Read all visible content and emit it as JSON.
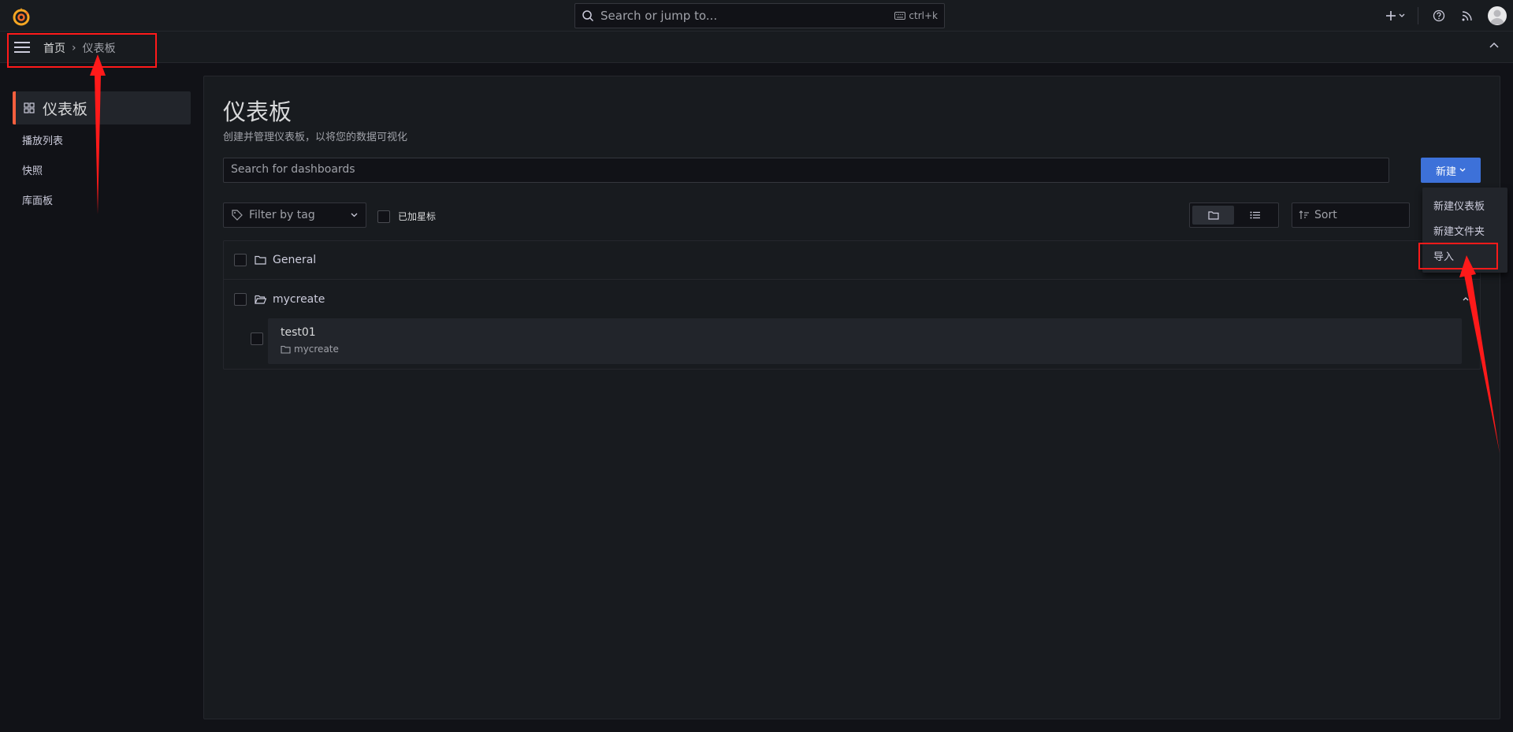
{
  "topbar": {
    "search_placeholder": "Search or jump to...",
    "shortcut": "ctrl+k"
  },
  "breadcrumb": {
    "home": "首页",
    "separator": "›",
    "current": "仪表板"
  },
  "sidebar": {
    "active_label": "仪表板",
    "items": [
      {
        "label": "播放列表"
      },
      {
        "label": "快照"
      },
      {
        "label": "库面板"
      }
    ]
  },
  "main": {
    "title": "仪表板",
    "subtitle": "创建并管理仪表板，以将您的数据可视化",
    "search_placeholder": "Search for dashboards",
    "new_button": "新建",
    "tag_filter_placeholder": "Filter by tag",
    "starred_label": "已加星标",
    "sort_placeholder": "Sort"
  },
  "folders": [
    {
      "name": "General"
    },
    {
      "name": "mycreate",
      "dashboards": [
        {
          "title": "test01",
          "folder": "mycreate"
        }
      ]
    }
  ],
  "new_menu": {
    "items": [
      {
        "label": "新建仪表板"
      },
      {
        "label": "新建文件夹"
      },
      {
        "label": "导入"
      }
    ]
  },
  "colors": {
    "background": "#111217",
    "panel": "#181b1f",
    "primary_button": "#3d71d9",
    "accent": "#f55f3e",
    "annotation": "#ff1a1a"
  }
}
